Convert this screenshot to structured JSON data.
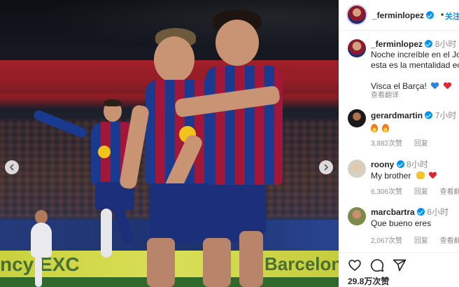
{
  "post": {
    "nav": {
      "prev_icon": "chevron-left-icon",
      "next_icon": "chevron-right-icon"
    },
    "banner_left": "ncy EXC",
    "banner_right": "Barcelon"
  },
  "header": {
    "username": "_ferminlopez",
    "separator": "•",
    "follow_label": "关注"
  },
  "caption": {
    "username": "_ferminlopez",
    "time": "8小时",
    "line1": "Noche increíble en el Jo",
    "line2": "esta es la mentalidad ec",
    "line3": "Visca el Barça!",
    "translate": "查看翻译"
  },
  "comments": [
    {
      "username": "gerardmartin",
      "time": "7小时",
      "text": "",
      "likes": "3,882次赞",
      "reply": "回复",
      "translate": ""
    },
    {
      "username": "roony",
      "time": "8小时",
      "text": "My brother",
      "likes": "6,306次赞",
      "reply": "回复",
      "translate": "查看翻译"
    },
    {
      "username": "marcbartra",
      "time": "6小时",
      "text": "Que bueno eres",
      "likes": "2,067次赞",
      "reply": "回复",
      "translate": "查看翻译"
    }
  ],
  "actions": {
    "like_icon": "heart-icon",
    "comment_icon": "comment-icon",
    "share_icon": "send-icon"
  },
  "likes_count": "29.8万次赞",
  "colors": {
    "link_blue": "#0095f6",
    "verified_blue": "#0095f6",
    "muted": "#8e8e8e"
  }
}
